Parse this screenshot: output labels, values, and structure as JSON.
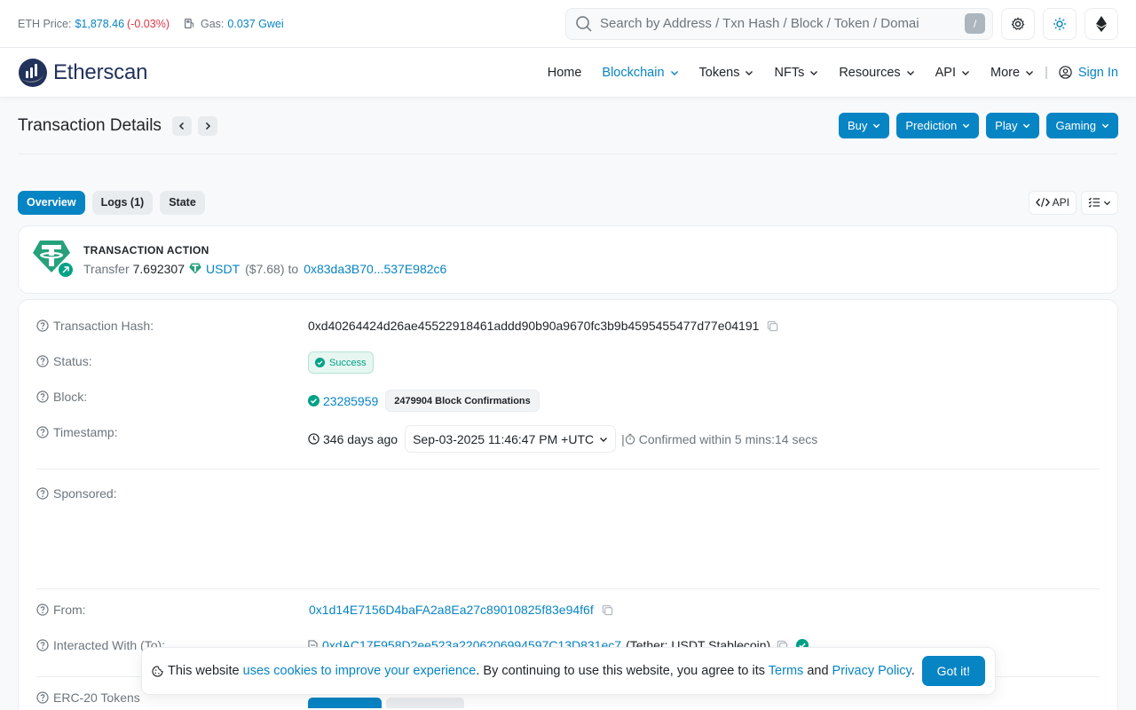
{
  "topbar": {
    "eth_price_label": "ETH Price:",
    "eth_price_value": "$1,878.46",
    "eth_price_change": "(-0.03%)",
    "gas_label": "Gas:",
    "gas_value": "0.037 Gwei",
    "search_placeholder": "Search by Address / Txn Hash / Block / Token / Domai",
    "search_shortcut": "/"
  },
  "navbar": {
    "brand": "Etherscan",
    "items": [
      {
        "label": "Home"
      },
      {
        "label": "Blockchain"
      },
      {
        "label": "Tokens"
      },
      {
        "label": "NFTs"
      },
      {
        "label": "Resources"
      },
      {
        "label": "API"
      },
      {
        "label": "More"
      }
    ],
    "sign_in": "Sign In"
  },
  "page": {
    "title": "Transaction Details",
    "ctas": [
      "Buy",
      "Prediction",
      "Play",
      "Gaming"
    ]
  },
  "tabs": {
    "overview": "Overview",
    "logs": "Logs (1)",
    "state": "State",
    "api_button": "API"
  },
  "action": {
    "title": "TRANSACTION ACTION",
    "verb": "Transfer",
    "amount": "7.692307",
    "token": "USDT",
    "usd": "($7.68)",
    "to_word": "to",
    "to_address": "0x83da3B70...537E982c6"
  },
  "details": {
    "hash_label": "Transaction Hash:",
    "hash_value": "0xd40264424d26ae45522918461addd90b90a9670fc3b9b4595455477d77e04191",
    "status_label": "Status:",
    "status_value": "Success",
    "block_label": "Block:",
    "block_value": "23285959",
    "block_confirmations": "2479904 Block Confirmations",
    "timestamp_label": "Timestamp:",
    "timestamp_ago": "346 days ago",
    "timestamp_value": "Sep-03-2025 11:46:47 PM +UTC",
    "confirmed_within": "Confirmed within 5 mins:14 secs",
    "sponsored_label": "Sponsored:",
    "from_label": "From:",
    "from_value": "0x1d14E7156D4baFA2a8Ea27c89010825f83e94f6f",
    "to_label": "Interacted With (To):",
    "to_value": "0xdAC17F958D2ee523a2206206994597C13D831ec7",
    "to_name": "(Tether: USDT Stablecoin)",
    "erc20_label": "ERC-20 Tokens"
  },
  "cookie": {
    "prefix": "This website",
    "link1": "uses cookies to improve your experience",
    "middle": ". By continuing to use this website, you agree to its",
    "terms": "Terms",
    "and": "and",
    "privacy": "Privacy Policy",
    "period": ".",
    "button": "Got it!"
  },
  "colors": {
    "accent": "#0784c3",
    "success": "#00a186",
    "tether": "#26a17b",
    "negative": "#dc3545"
  }
}
